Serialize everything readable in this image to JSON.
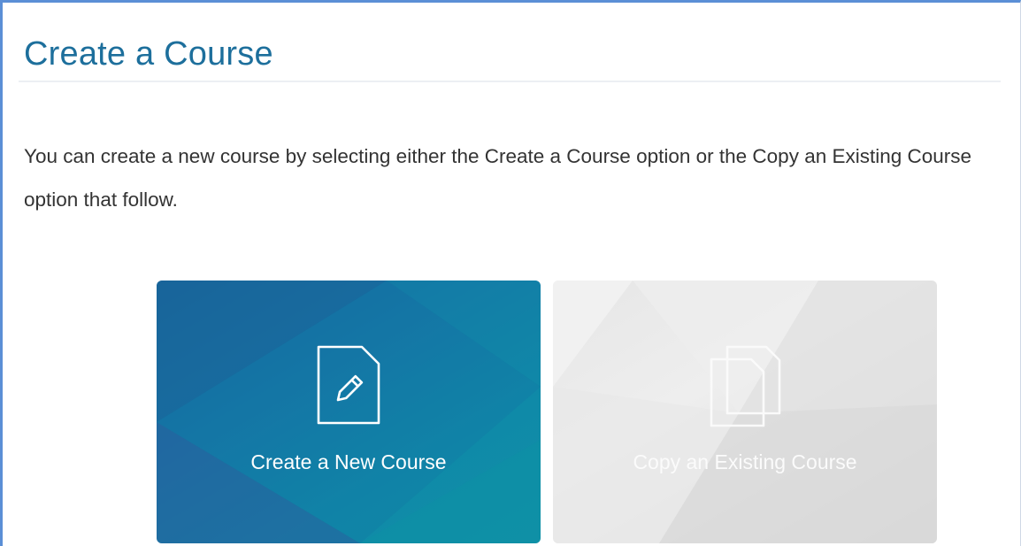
{
  "page": {
    "title": "Create a Course",
    "intro": "You can create a new course by selecting either the Create a Course option or the Copy an Existing Course option that follow."
  },
  "options": [
    {
      "label": "Create a New Course",
      "icon": "document-pencil-icon",
      "state": "active",
      "color": "#1672a3"
    },
    {
      "label": "Copy an Existing Course",
      "icon": "copy-documents-icon",
      "state": "disabled",
      "color": "#e3e3e3"
    }
  ],
  "colors": {
    "title": "#1d6f9c",
    "frame_border": "#5b8fd6",
    "body_text": "#333333"
  }
}
